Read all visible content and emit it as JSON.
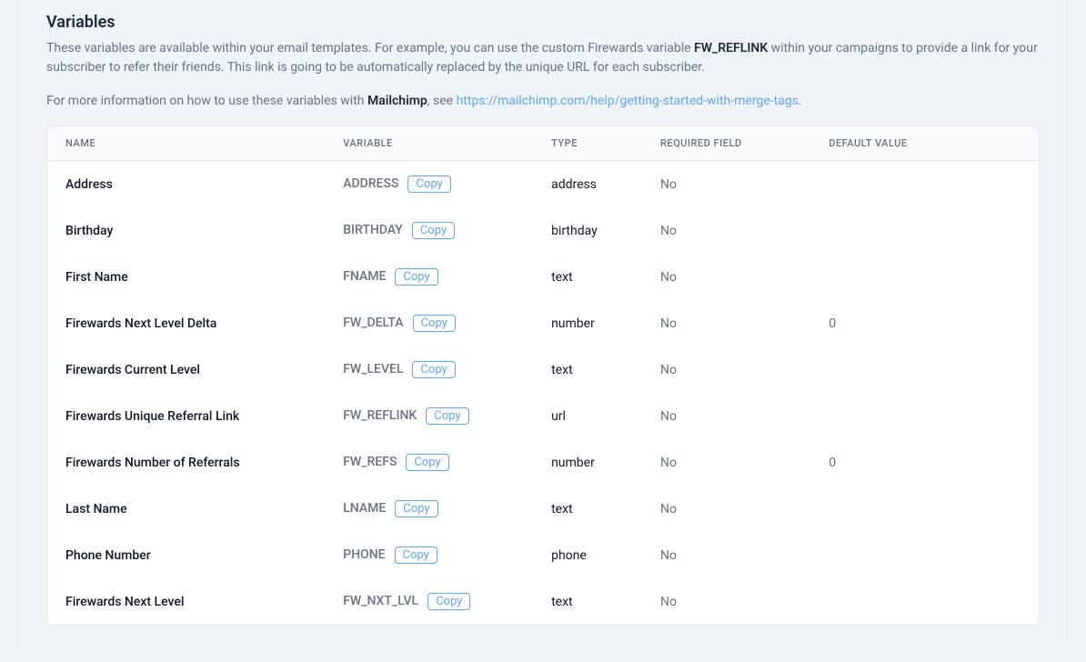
{
  "section": {
    "title": "Variables",
    "desc_part1": "These variables are available within your email templates. For example, you can use the custom Firewards variable ",
    "desc_bold": "FW_REFLINK",
    "desc_part2": " within your campaigns to provide a link for your subscriber to refer their friends. This link is going to be automatically replaced by the unique URL for each subscriber.",
    "desc2_part1": "For more information on how to use these variables with ",
    "desc2_bold": "Mailchimp",
    "desc2_part2": ", see ",
    "desc2_link_text": "https://mailchimp.com/help/getting-started-with-merge-tags",
    "desc2_part3": "."
  },
  "table": {
    "headers": {
      "name": "NAME",
      "variable": "VARIABLE",
      "type": "TYPE",
      "required": "REQUIRED FIELD",
      "default": "DEFAULT VALUE"
    },
    "copy_label": "Copy",
    "rows": [
      {
        "name": "Address",
        "variable": "ADDRESS",
        "type": "address",
        "required": "No",
        "default": ""
      },
      {
        "name": "Birthday",
        "variable": "BIRTHDAY",
        "type": "birthday",
        "required": "No",
        "default": ""
      },
      {
        "name": "First Name",
        "variable": "FNAME",
        "type": "text",
        "required": "No",
        "default": ""
      },
      {
        "name": "Firewards Next Level Delta",
        "variable": "FW_DELTA",
        "type": "number",
        "required": "No",
        "default": "0"
      },
      {
        "name": "Firewards Current Level",
        "variable": "FW_LEVEL",
        "type": "text",
        "required": "No",
        "default": ""
      },
      {
        "name": "Firewards Unique Referral Link",
        "variable": "FW_REFLINK",
        "type": "url",
        "required": "No",
        "default": ""
      },
      {
        "name": "Firewards Number of Referrals",
        "variable": "FW_REFS",
        "type": "number",
        "required": "No",
        "default": "0"
      },
      {
        "name": "Last Name",
        "variable": "LNAME",
        "type": "text",
        "required": "No",
        "default": ""
      },
      {
        "name": "Phone Number",
        "variable": "PHONE",
        "type": "phone",
        "required": "No",
        "default": ""
      },
      {
        "name": "Firewards Next Level",
        "variable": "FW_NXT_LVL",
        "type": "text",
        "required": "No",
        "default": ""
      }
    ]
  }
}
